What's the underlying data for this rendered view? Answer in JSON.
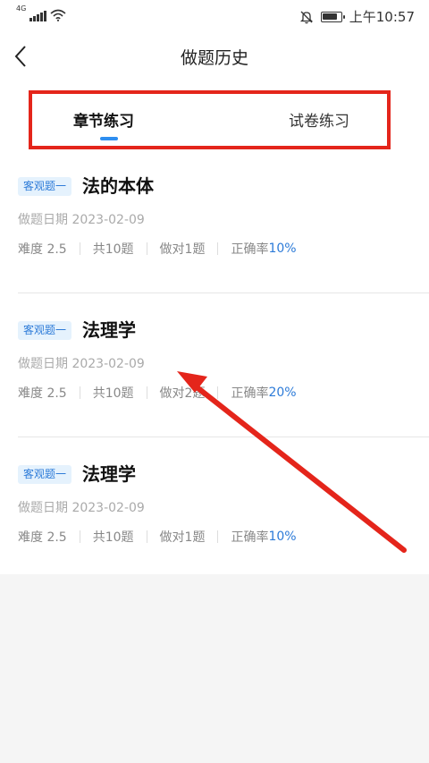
{
  "status_bar": {
    "signal_label": "4G",
    "time": "上午10:57",
    "battery_level": 0.85
  },
  "header": {
    "title": "做题历史",
    "back_icon": "chevron-left-icon"
  },
  "tabs": [
    {
      "label": "章节练习",
      "active": true
    },
    {
      "label": "试卷练习",
      "active": false
    }
  ],
  "records": [
    {
      "tag": "客观题一",
      "title": "法的本体",
      "date": "做题日期 2023-02-09",
      "difficulty": "难度 2.5",
      "total": "共10题",
      "correct": "做对1题",
      "accuracy_label": "正确率",
      "accuracy_value": "10%"
    },
    {
      "tag": "客观题一",
      "title": "法理学",
      "date": "做题日期 2023-02-09",
      "difficulty": "难度 2.5",
      "total": "共10题",
      "correct": "做对2题",
      "accuracy_label": "正确率",
      "accuracy_value": "20%"
    },
    {
      "tag": "客观题一",
      "title": "法理学",
      "date": "做题日期 2023-02-09",
      "difficulty": "难度 2.5",
      "total": "共10题",
      "correct": "做对1题",
      "accuracy_label": "正确率",
      "accuracy_value": "10%"
    }
  ],
  "colors": {
    "accent": "#2d7bd8",
    "tab_indicator": "#2f8ef0",
    "annotation": "#e4251b"
  }
}
